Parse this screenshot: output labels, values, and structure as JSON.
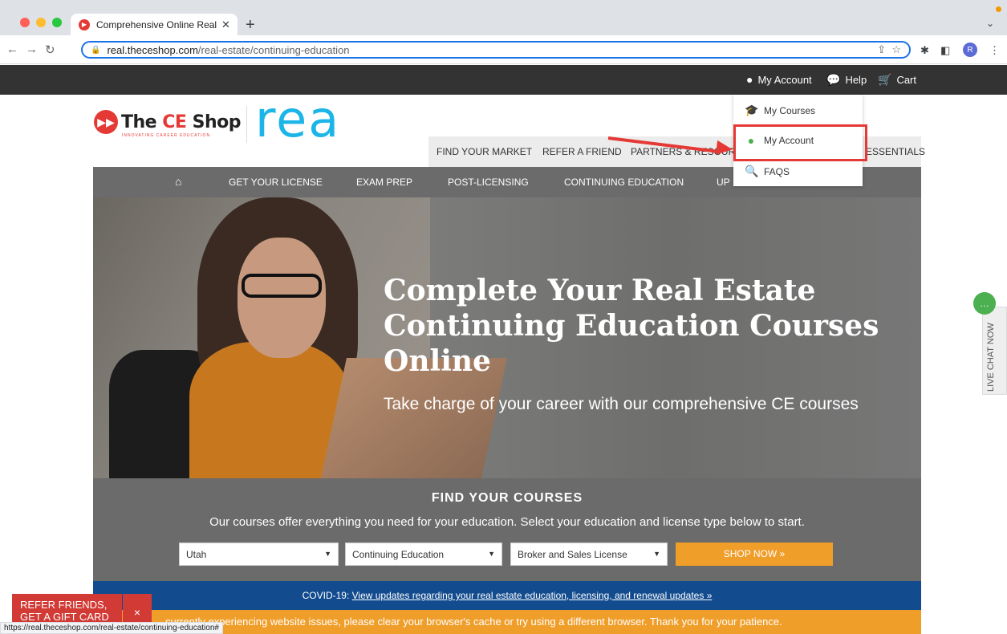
{
  "browser": {
    "tab_title": "Comprehensive Online Real Es",
    "url_domain": "real.theceshop.com",
    "url_path": "/real-estate/continuing-education",
    "profile_initial": "R",
    "status_url": "https://real.theceshop.com/real-estate/continuing-education#"
  },
  "topbar": {
    "my_account": "My Account",
    "help": "Help",
    "cart": "Cart"
  },
  "logo": {
    "the": "The ",
    "ce": "CE",
    "shop": " Shop",
    "tagline": "INNOVATING CAREER EDUCATION",
    "real": "rea"
  },
  "secnav": [
    "FIND YOUR MARKET",
    "REFER A FRIEND",
    "PARTNERS & RESOURCES",
    "ESSENTIALS"
  ],
  "mainnav": [
    "GET YOUR LICENSE",
    "EXAM PREP",
    "POST-LICENSING",
    "CONTINUING EDUCATION",
    "UP"
  ],
  "dropdown": {
    "my_courses": "My Courses",
    "my_account": "My Account",
    "faqs": "FAQS"
  },
  "hero": {
    "title": "Complete Your Real Estate Continuing Education Courses Online",
    "subtitle": "Take charge of your career with our comprehensive CE courses"
  },
  "finder": {
    "title": "FIND YOUR COURSES",
    "description": "Our courses offer everything you need for your education. Select your education and license type below to start.",
    "state": "Utah",
    "education": "Continuing Education",
    "license": "Broker and Sales License",
    "shop_now": "SHOP NOW »"
  },
  "covid": {
    "prefix": "COVID-19: ",
    "link": "View updates regarding your real estate education, licensing, and renewal updates »"
  },
  "notice": {
    "text": "currently experiencing website issues, please clear your browser's cache or try using a different browser. Thank you for your patience."
  },
  "refer": {
    "line1": "REFER FRIENDS,",
    "line2": "GET A GIFT CARD",
    "close": "×"
  },
  "livechat": {
    "label": "LIVE CHAT NOW"
  },
  "colors": {
    "brand_red": "#e53935",
    "real_blue": "#1cb5e8",
    "nav_gray": "#6b6b6b",
    "orange": "#f09e2a",
    "covid_blue": "#124b8e",
    "icon_green": "#4caf50"
  }
}
